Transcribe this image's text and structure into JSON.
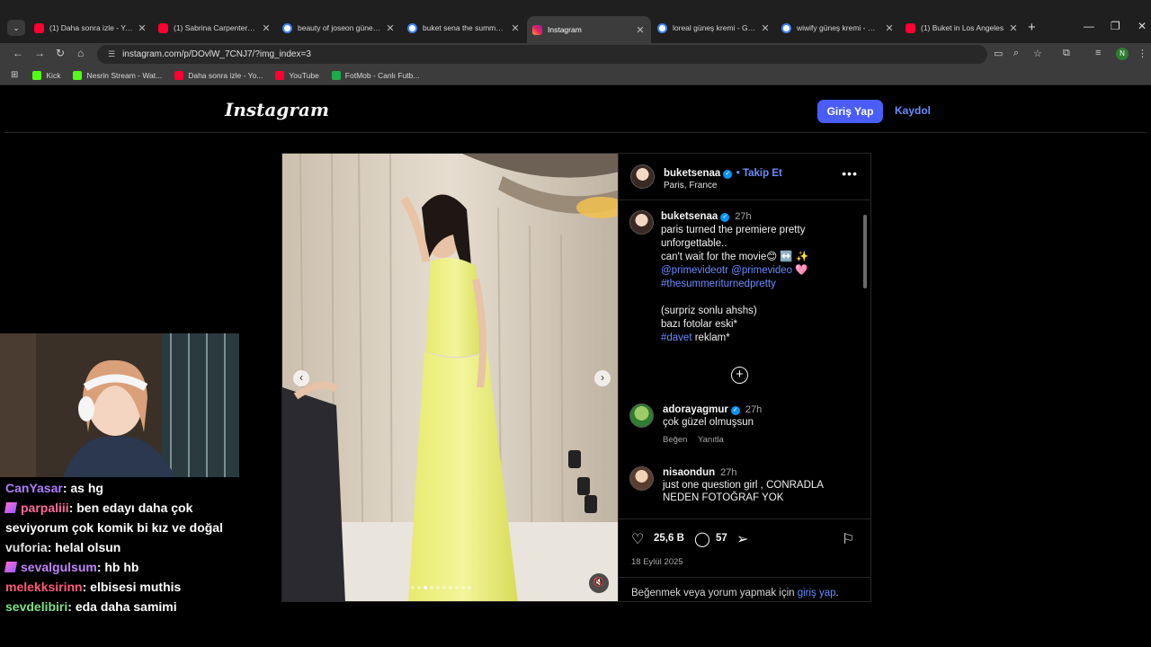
{
  "browser": {
    "tabs": [
      {
        "title": "(1) Daha sonra izle - YouTube",
        "favicon": "youtube-icon",
        "active": false
      },
      {
        "title": "(1) Sabrina Carpenter - Espresso",
        "favicon": "youtube-icon",
        "active": false
      },
      {
        "title": "beauty of joseon güneş kremi",
        "favicon": "google-icon",
        "active": false
      },
      {
        "title": "buket sena the summer i turned",
        "favicon": "google-icon",
        "active": false
      },
      {
        "title": "Instagram",
        "favicon": "instagram-icon",
        "active": true
      },
      {
        "title": "loreal güneş kremi - Google",
        "favicon": "google-icon",
        "active": false
      },
      {
        "title": "wiwify güneş kremi - Google",
        "favicon": "google-icon",
        "active": false
      },
      {
        "title": "(1) Buket in Los Angeles",
        "favicon": "youtube-icon",
        "active": false
      }
    ],
    "url": "instagram.com/p/DOvlW_7CNJ7/?img_index=3",
    "profile_initial": "N",
    "bookmarks": [
      {
        "label": "Kick",
        "icon": "kick-icon"
      },
      {
        "label": "Nesrin Stream - Wat...",
        "icon": "kick-icon"
      },
      {
        "label": "Daha sonra izle - Yo...",
        "icon": "youtube-icon"
      },
      {
        "label": "YouTube",
        "icon": "youtube-icon"
      },
      {
        "label": "FotMob - Canlı Futb...",
        "icon": "fotmob-icon"
      }
    ]
  },
  "instagram": {
    "logo": "Instagram",
    "login_button": "Giriş Yap",
    "signup_link": "Kaydol"
  },
  "post": {
    "author": "buketsenaa",
    "follow_label": "• Takip Et",
    "location": "Paris, France",
    "caption": {
      "time": "27h",
      "line1": "paris turned the premiere pretty",
      "line2": "unforgettable..",
      "line3": "can't wait for the movie😊 ↔️ ✨",
      "mention1": "@primevideotr",
      "mention2": "@primevideo",
      "mention_tail": " 🩷",
      "hashtag1": "#thesummeriturnedpretty",
      "line5": "(surpriz sonlu ahshs)",
      "line6": "bazı fotolar eski*",
      "hashtag2": "#davet",
      "line7_tail": " reklam*"
    },
    "comments": [
      {
        "user": "adorayagmur",
        "verified": true,
        "time": "27h",
        "text": "çok güzel olmuşsun",
        "like": "Beğen",
        "reply": "Yanıtla"
      },
      {
        "user": "nisaondun",
        "verified": false,
        "time": "27h",
        "text": "just one question girl , CONRADLA NEDEN FOTOĞRAF YOK"
      }
    ],
    "likes": "25,6 B",
    "comment_count": "57",
    "date": "18 Eylül 2025",
    "login_prompt": "Beğenmek veya yorum yapmak için ",
    "login_prompt_link": "giriş yap",
    "login_prompt_end": ".",
    "carousel": {
      "count": 10,
      "active_index": 3
    }
  },
  "stream_chat": [
    {
      "user": "CanYasar",
      "color": "#b07cff",
      "badge": false,
      "message": ": as hg"
    },
    {
      "user": "parpaliii",
      "color": "#ff6b9d",
      "badge": true,
      "message": ": ben edayı daha çok seviyorum çok komik bi kız ve doğal"
    },
    {
      "user": "vuforia",
      "color": "#e0e0e0",
      "badge": false,
      "message": ": helal olsun"
    },
    {
      "user": "sevalgulsum",
      "color": "#c084fc",
      "badge": true,
      "message": ": hb hb"
    },
    {
      "user": "melekksirinn",
      "color": "#ff5a7a",
      "badge": false,
      "message": ": elbisesi muthis"
    },
    {
      "user": "sevdelibiri",
      "color": "#7ee081",
      "badge": false,
      "message": ": eda daha samimi"
    }
  ]
}
